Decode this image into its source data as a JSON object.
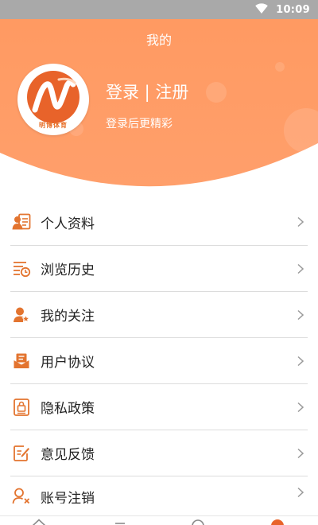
{
  "status_bar": {
    "time": "10:09",
    "wifi_icon": "wifi-icon"
  },
  "header": {
    "title": "我的",
    "login_link": "登录 | 注册",
    "login_subtitle": "登录后更精彩",
    "avatar_caption": "明博体育"
  },
  "colors": {
    "accent": "#ff9a63",
    "accent_dark": "#e7702a",
    "icon": "#e3742f",
    "status_bar": "#a9a9a9"
  },
  "menu": {
    "items": [
      {
        "label": "个人资料",
        "icon": "profile-card-icon"
      },
      {
        "label": "浏览历史",
        "icon": "history-list-icon"
      },
      {
        "label": "我的关注",
        "icon": "follow-star-icon"
      },
      {
        "label": "用户协议",
        "icon": "agreement-envelope-icon"
      },
      {
        "label": "隐私政策",
        "icon": "privacy-lock-icon"
      },
      {
        "label": "意见反馈",
        "icon": "feedback-edit-icon"
      },
      {
        "label": "账号注销",
        "icon": "account-remove-icon"
      }
    ]
  }
}
